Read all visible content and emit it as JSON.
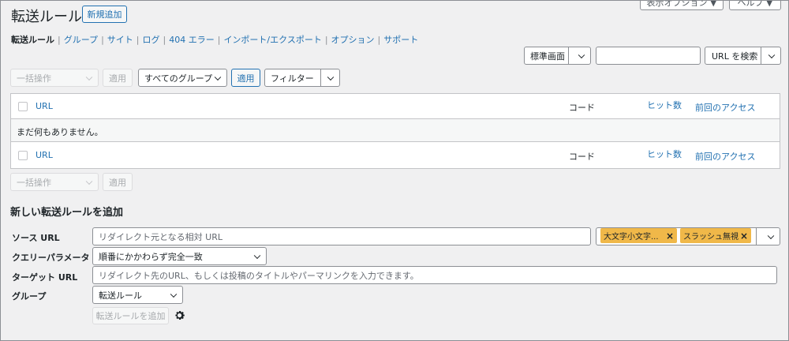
{
  "header": {
    "title": "転送ルール",
    "add_new": "新規追加",
    "screen_options": "表示オプション ▼",
    "help": "ヘルプ ▼"
  },
  "subnav": [
    {
      "label": "転送ルール",
      "current": true
    },
    {
      "label": "グループ"
    },
    {
      "label": "サイト"
    },
    {
      "label": "ログ"
    },
    {
      "label": "404 エラー"
    },
    {
      "label": "インポート/エクスポート"
    },
    {
      "label": "オプション"
    },
    {
      "label": "サポート"
    }
  ],
  "search": {
    "mode": "標準画面",
    "value": "",
    "button": "URL を検索"
  },
  "toolbar_top": {
    "bulk_action": "一括操作",
    "apply": "適用",
    "group_filter": "すべてのグループ",
    "group_apply": "適用",
    "filter": "フィルター"
  },
  "table": {
    "col_url": "URL",
    "col_code": "コード",
    "col_hits": "ヒット数",
    "col_last_access": "前回のアクセス",
    "empty": "まだ何もありません。"
  },
  "toolbar_bottom": {
    "bulk_action": "一括操作",
    "apply": "適用"
  },
  "add_form": {
    "heading": "新しい転送ルールを追加",
    "source_label": "ソース URL",
    "source_placeholder": "リダイレクト元となる相対 URL",
    "flag_case": "大文字小文字...",
    "flag_slash": "スラッシュ無視",
    "query_label": "クエリーパラメータ",
    "query_value": "順番にかかわらず完全一致",
    "target_label": "ターゲット URL",
    "target_placeholder": "リダイレクト先のURL、もしくは投稿のタイトルやパーマリンクを入力できます。",
    "group_label": "グループ",
    "group_value": "転送ルール",
    "submit": "転送ルールを追加"
  },
  "colors": {
    "accent": "#2271b1",
    "tag": "#f0b849",
    "background": "#f0f0f1"
  }
}
